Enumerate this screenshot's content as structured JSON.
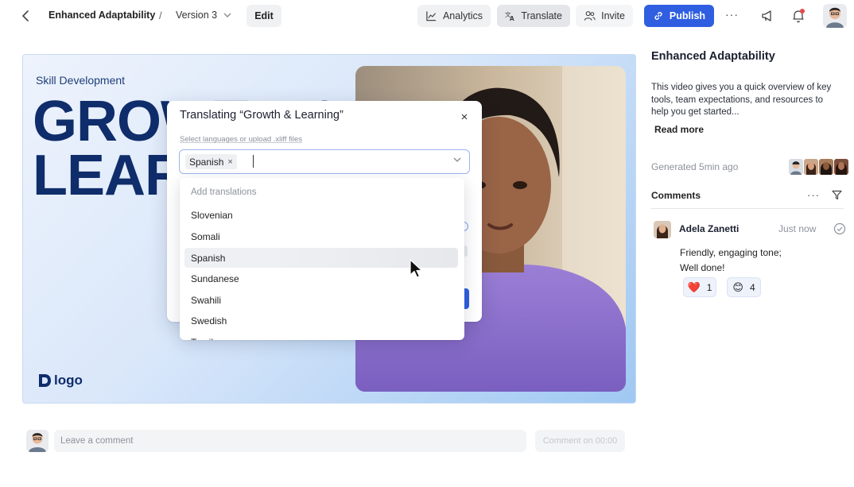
{
  "header": {
    "doc_title": "Enhanced Adaptability",
    "separator": "/",
    "version": "Version 3",
    "edit_label": "Edit",
    "analytics_label": "Analytics",
    "translate_label": "Translate",
    "invite_label": "Invite",
    "publish_label": "Publish",
    "more_label": "···",
    "accent_color": "#2f5fe0"
  },
  "slide": {
    "subtitle": "Skill Development",
    "big_line1": "GROWTH &",
    "big_line2": "LEARNING",
    "logo_text": "logo"
  },
  "translate_modal": {
    "title": "Translating “Growth & Learning”",
    "close_label": "×",
    "hint": "Select languages or upload .xliff files",
    "selected_chip": "Spanish",
    "chip_remove": "×",
    "dropdown": {
      "header": "Add translations",
      "items": [
        "Slovenian",
        "Somali",
        "Spanish",
        "Sundanese",
        "Swahili",
        "Swedish",
        "Tamil"
      ],
      "hovered": "Spanish"
    }
  },
  "right_panel": {
    "title": "Enhanced Adaptability",
    "description": "This video gives you a quick overview of key tools, team expectations, and resources to help you get started...",
    "read_more": "Read more",
    "generated": "Generated 5min ago",
    "comments_label": "Comments",
    "more_label": "···",
    "comment": {
      "author": "Adela Zanetti",
      "time": "Just now",
      "text_line1": "Friendly, engaging tone;",
      "text_line2": "Well done!",
      "reactions": [
        {
          "emoji": "❤️",
          "count": "1"
        },
        {
          "emoji": "😊",
          "count": "4"
        }
      ]
    }
  },
  "bottom": {
    "comment_placeholder": "Leave a comment",
    "submit_label": "Comment on 00:00"
  }
}
